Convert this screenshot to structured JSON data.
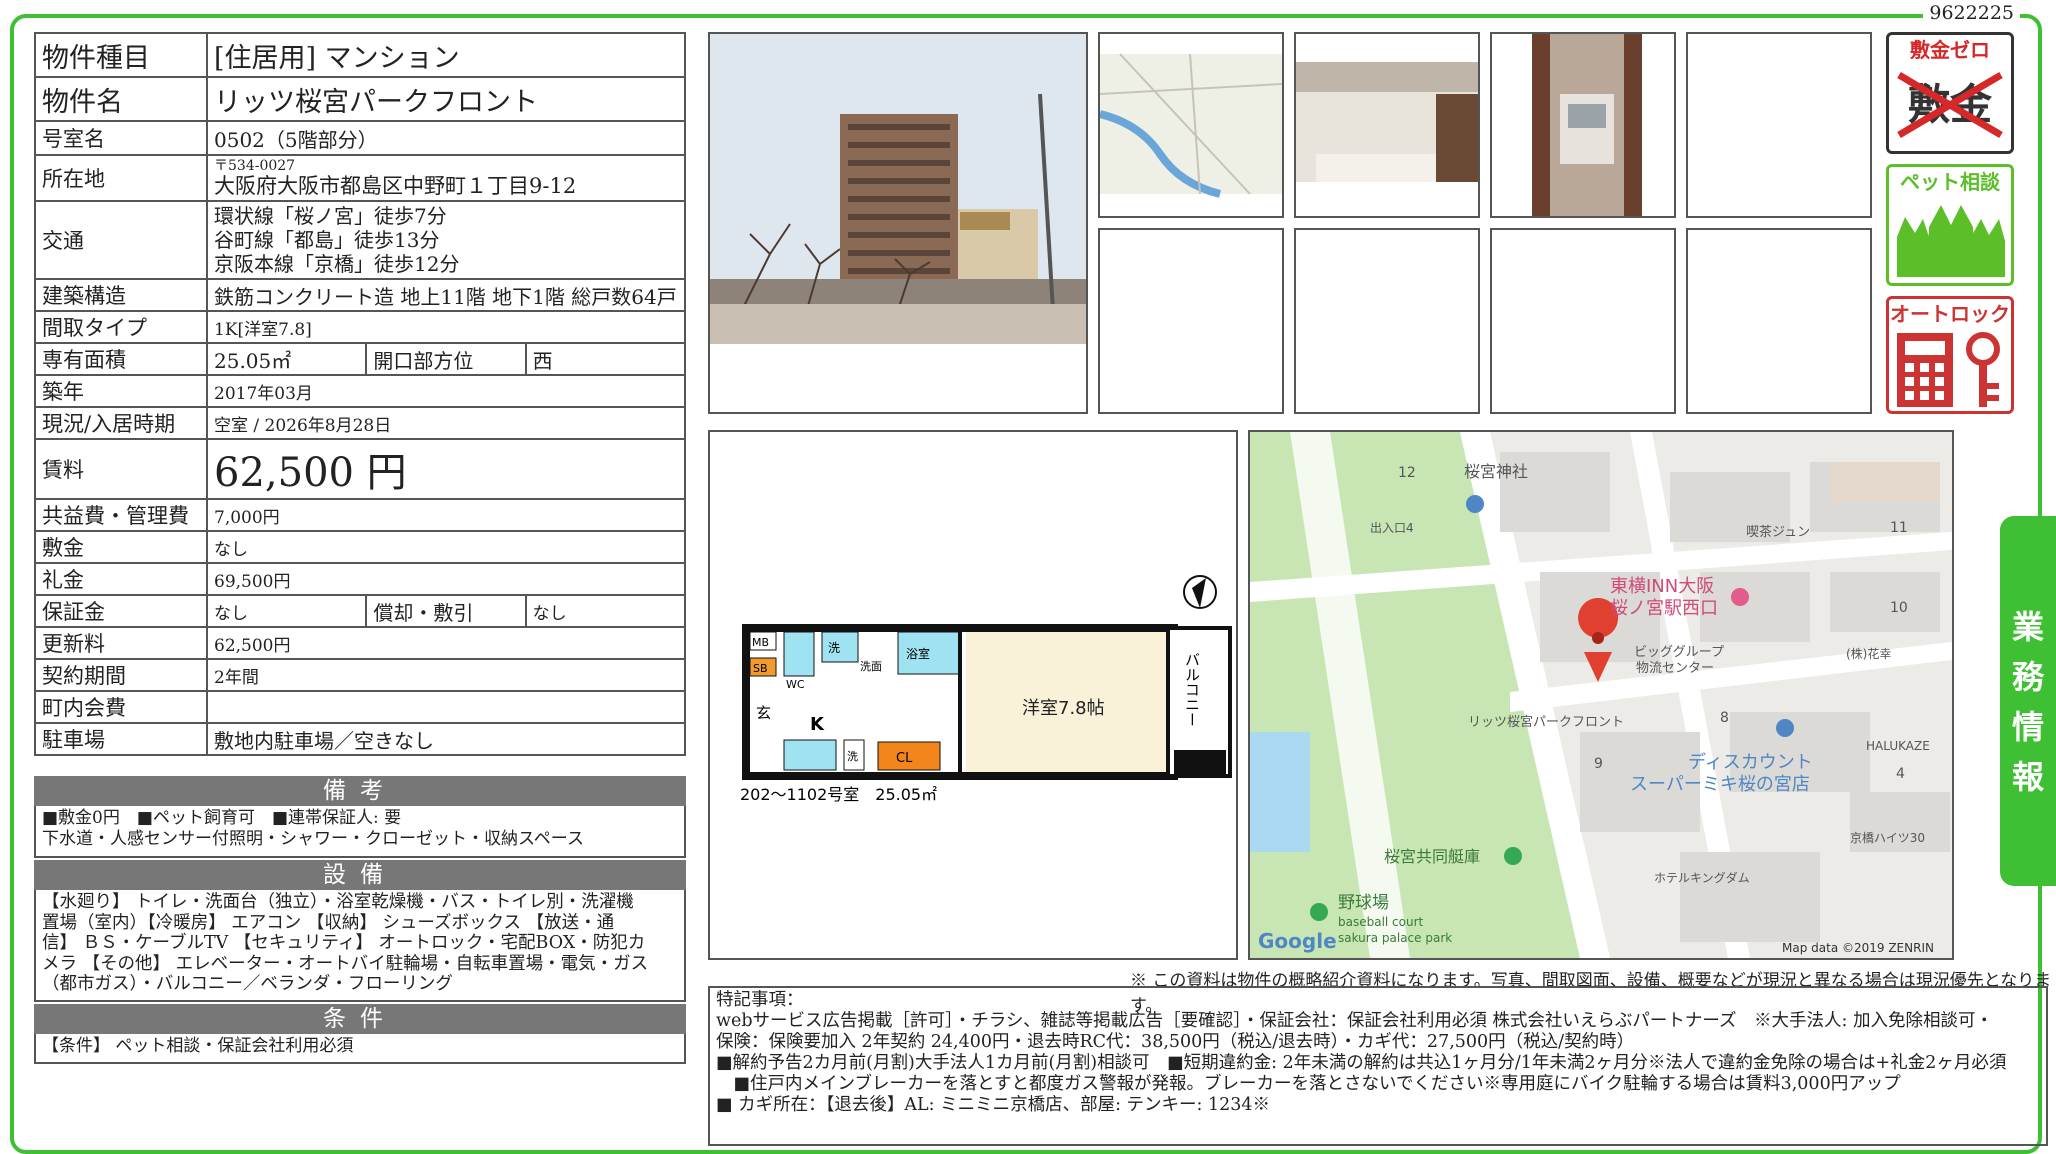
{
  "doc_id": "9622225",
  "property": {
    "type_label": "物件種目",
    "type_value": "[住居用] マンション",
    "name_label": "物件名",
    "name_value": "リッツ桜宮パークフロント",
    "room_label": "号室名",
    "room_value": "0502（5階部分）",
    "address_label": "所在地",
    "zip": "〒534-0027",
    "address": "大阪府大阪市都島区中野町１丁目9-12",
    "transport_label": "交通",
    "transport": [
      "環状線「桜ノ宮」徒歩7分",
      "谷町線「都島」徒歩13分",
      "京阪本線「京橋」徒歩12分"
    ],
    "structure_label": "建築構造",
    "structure_value": "鉄筋コンクリート造 地上11階 地下1階 総戸数64戸",
    "layout_label": "間取タイプ",
    "layout_value": "1K[洋室7.8]",
    "area_label": "専有面積",
    "area_value": "25.05㎡",
    "facing_label": "開口部方位",
    "facing_value": "西",
    "built_label": "築年",
    "built_value": "2017年03月",
    "status_label": "現況/入居時期",
    "status_value": "空室 / 2026年8月28日",
    "rent_label": "賃料",
    "rent_value": "62,500 円",
    "fee_label": "共益費・管理費",
    "fee_value": "7,000円",
    "deposit_label": "敷金",
    "deposit_value": "なし",
    "keymoney_label": "礼金",
    "keymoney_value": "69,500円",
    "guarantee_label": "保証金",
    "guarantee_value": "なし",
    "amort_label": "償却・敷引",
    "amort_value": "なし",
    "renew_label": "更新料",
    "renew_value": "62,500円",
    "term_label": "契約期間",
    "term_value": "2年間",
    "town_label": "町内会費",
    "town_value": "",
    "parking_label": "駐車場",
    "parking_value": "敷地内駐車場／空きなし"
  },
  "sections": {
    "notes_title": "備考",
    "notes": [
      "■敷金0円　■ペット飼育可　■連帯保証人: 要",
      "下水道・人感センサー付照明・シャワー・クローゼット・収納スペース"
    ],
    "equip_title": "設備",
    "equip": [
      "【水廻り】 トイレ・洗面台（独立）・浴室乾燥機・バス・トイレ別・洗濯機",
      "置場（室内）【冷暖房】 エアコン 【収納】 シューズボックス 【放送・通",
      "信】 ＢＳ・ケーブルTV 【セキュリティ】 オートロック・宅配BOX・防犯カ",
      "メラ 【その他】 エレベーター・オートバイ駐輪場・自転車置場・電気・ガス",
      "（都市ガス）・バルコニー／ベランダ・フローリング"
    ],
    "cond_title": "条件",
    "cond": [
      "【条件】 ペット相談・保証会社利用必須"
    ]
  },
  "badges": {
    "zero_deposit": "敷金ゼロ",
    "zero_deposit_big": "敷金",
    "pet": "ペット相談",
    "autolock": "オートロック"
  },
  "side_tab": "業務情報",
  "floorplan": {
    "room": "洋室7.8帖",
    "balcony": "バルコニー",
    "caption": "202〜1102号室　25.05㎡",
    "labels": {
      "mb": "MB",
      "sb": "SB",
      "wash": "洗",
      "wc": "WC",
      "washroom": "洗面",
      "bath": "浴室",
      "entry": "玄",
      "kitchen": "K",
      "cl": "CL",
      "laundry": "洗"
    }
  },
  "map": {
    "labels": [
      "12",
      "桜宮神社",
      "出入口4",
      "喫茶ジュン",
      "11",
      "東横INN大阪",
      "桜ノ宮駅西口",
      "10",
      "ビッググループ",
      "物流センター",
      "(株)花幸",
      "リッツ桜宮パークフロント",
      "8",
      "9",
      "ディスカウント",
      "スーパーミキ桜の宮店",
      "HALUKAZE",
      "4",
      "京橋ハイツ30",
      "桜宮共同艇庫",
      "ホテルキングダム",
      "野球場",
      "baseball court",
      "sakura palace park"
    ],
    "google": "Google",
    "attribution": "Map data ©2019 ZENRIN"
  },
  "footer_note": "※ この資料は物件の概略紹介資料になります。写真、間取図面、設備、概要などが現況と異なる場合は現況優先となります。",
  "remarks": {
    "title": "特記事項：",
    "lines": [
      "webサービス広告掲載［許可］・チラシ、雑誌等掲載広告［要確認］・保証会社：保証会社利用必須 株式会社いえらぶパートナーズ　※大手法人: 加入免除相談可・",
      "保険：保険要加入 2年契約 24,400円・退去時RC代：38,500円（税込/退去時）・カギ代：27,500円（税込/契約時）",
      "■解約予告2カ月前(月割)大手法人1カ月前(月割)相談可　■短期違約金: 2年未満の解約は共込1ヶ月分/1年未満2ヶ月分※法人で違約金免除の場合は+礼金2ヶ月必須",
      "　■住戸内メインブレーカーを落とすと都度ガス警報が発報。ブレーカーを落とさないでください※専用庭にバイク駐輪する場合は賃料3,000円アップ",
      "■ カギ所在：【退去後】AL: ミニミニ京橋店、部屋: テンキー: 1234※"
    ]
  }
}
